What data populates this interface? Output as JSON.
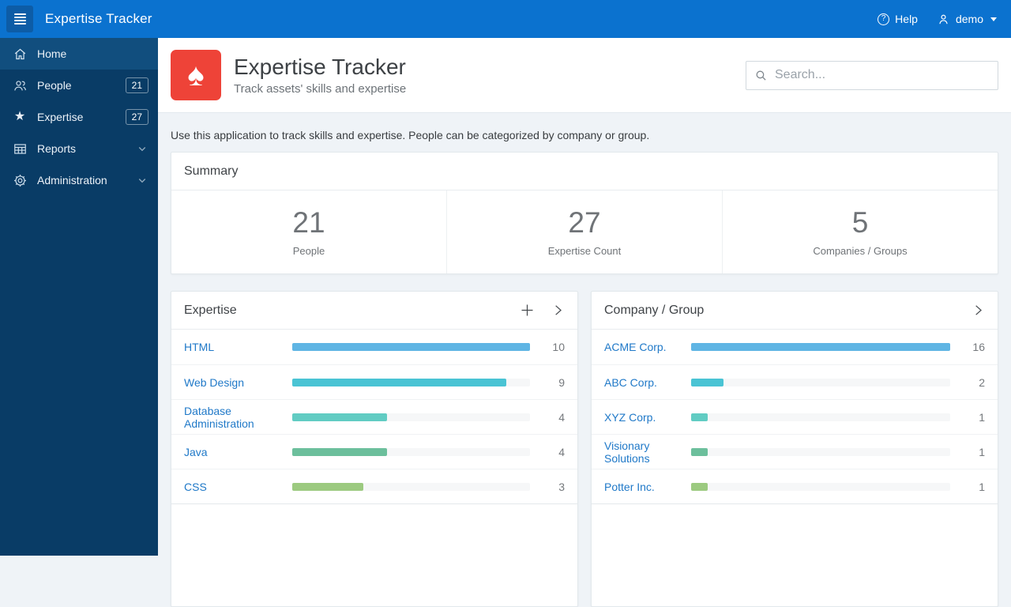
{
  "app_bar": {
    "title": "Expertise Tracker",
    "help_label": "Help",
    "user_label": "demo"
  },
  "sidebar": {
    "items": [
      {
        "label": "Home",
        "icon": "home-icon",
        "active": true
      },
      {
        "label": "People",
        "icon": "people-icon",
        "badge": "21"
      },
      {
        "label": "Expertise",
        "icon": "star-icon",
        "badge": "27"
      },
      {
        "label": "Reports",
        "icon": "report-grid-icon",
        "expandable": true
      },
      {
        "label": "Administration",
        "icon": "gear-icon",
        "expandable": true
      }
    ]
  },
  "page_header": {
    "title": "Expertise Tracker",
    "subtitle": "Track assets' skills and expertise",
    "app_icon": "spade-icon",
    "app_icon_glyph": "♠",
    "search_placeholder": "Search..."
  },
  "intro_text": "Use this application to track skills and expertise. People can be categorized by company or group.",
  "summary": {
    "title": "Summary",
    "stats": [
      {
        "value": "21",
        "label": "People"
      },
      {
        "value": "27",
        "label": "Expertise Count"
      },
      {
        "value": "5",
        "label": "Companies / Groups"
      }
    ]
  },
  "chart_data": [
    {
      "type": "bar",
      "orientation": "horizontal",
      "title": "Expertise",
      "categories": [
        "HTML",
        "Web Design",
        "Database Administration",
        "Java",
        "CSS"
      ],
      "values": [
        10,
        9,
        4,
        4,
        3
      ],
      "max": 10,
      "bar_colors": [
        "#5fb5e4",
        "#4ac4d4",
        "#61ccc3",
        "#6cbf9c",
        "#9cca80"
      ],
      "header_actions": [
        "add",
        "open"
      ]
    },
    {
      "type": "bar",
      "orientation": "horizontal",
      "title": "Company / Group",
      "categories": [
        "ACME Corp.",
        "ABC Corp.",
        "XYZ Corp.",
        "Visionary Solutions",
        "Potter Inc."
      ],
      "values": [
        16,
        2,
        1,
        1,
        1
      ],
      "max": 16,
      "bar_colors": [
        "#5fb5e4",
        "#4ac4d4",
        "#61ccc3",
        "#6cbf9c",
        "#9cca80"
      ],
      "header_actions": [
        "open"
      ]
    }
  ],
  "colors": {
    "app_bar_bg": "#0b72cf",
    "hamburger_bg": "#0d5ca6",
    "sidebar_bg": "#093c66",
    "sidebar_active_bg": "#114e7e",
    "app_icon_bg": "#ee4338",
    "link": "#2079c8",
    "page_bg": "#eff3f7",
    "bar_track": "#f6f7f8"
  }
}
